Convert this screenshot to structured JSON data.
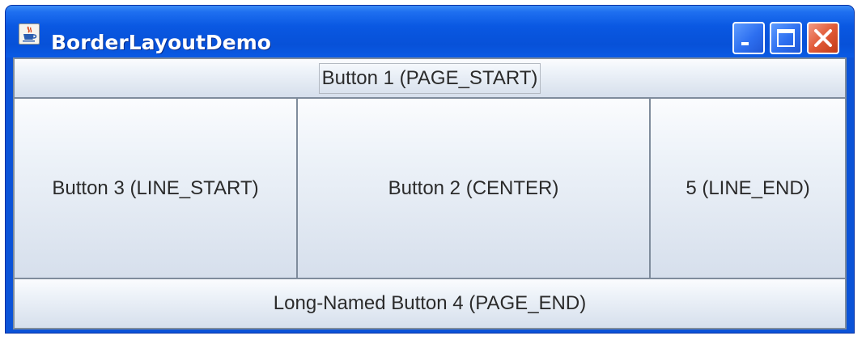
{
  "window": {
    "title": "BorderLayoutDemo",
    "app_icon": "java-icon",
    "controls": {
      "minimize": "minimize-icon",
      "maximize": "maximize-icon",
      "close": "close-icon"
    }
  },
  "buttons": {
    "page_start": "Button 1 (PAGE_START)",
    "line_start": "Button 3 (LINE_START)",
    "center": "Button 2 (CENTER)",
    "line_end": "5 (LINE_END)",
    "page_end": "Long-Named Button 4 (PAGE_END)"
  },
  "colors": {
    "titlebar": "#0b53d8",
    "close_button": "#e15a37"
  }
}
